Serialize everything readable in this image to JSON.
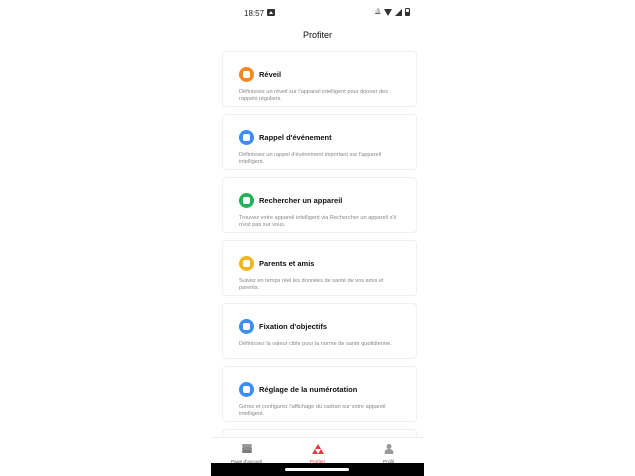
{
  "status_bar": {
    "time": "18:57",
    "icons": [
      "gallery-icon",
      "bell-off-icon",
      "wifi-icon",
      "signal-icon",
      "battery-icon"
    ]
  },
  "header": {
    "title": "Profiter"
  },
  "cards": [
    {
      "title": "Réveil",
      "description": "Définissez un réveil sur l'appareil intelligent pour donner des rappels réguliers.",
      "icon": "alarm-clock-icon",
      "color": "#F28A22"
    },
    {
      "title": "Rappel d'événement",
      "description": "Définissez un rappel d'événement important sur l'appareil intelligent.",
      "icon": "calendar-icon",
      "color": "#3D8DF5"
    },
    {
      "title": "Rechercher un appareil",
      "description": "Trouvez votre appareil intelligent via Rechercher un appareil s'il n'est pas sur vous.",
      "icon": "device-search-icon",
      "color": "#21B35A"
    },
    {
      "title": "Parents et amis",
      "description": "Suivez en temps réel les données de santé de vos amis et parents.",
      "icon": "people-icon",
      "color": "#F2B51B"
    },
    {
      "title": "Fixation d'objectifs",
      "description": "Définissez la valeur cible pour la norme de santé quotidienne.",
      "icon": "target-icon",
      "color": "#3D8DF5"
    },
    {
      "title": "Réglage de la numérotation",
      "description": "Gérez et configurez l'affichage du cadran sur votre appareil intelligent.",
      "icon": "watch-face-icon",
      "color": "#3D8DF5"
    },
    {
      "title": "",
      "description": "",
      "icon": "partial-card-icon",
      "color": "#21B35A"
    }
  ],
  "tabs": [
    {
      "label": "Page d'accueil",
      "icon": "home-stack-icon",
      "active": false
    },
    {
      "label": "Profiter",
      "icon": "profiter-icon",
      "active": true
    },
    {
      "label": "Profil",
      "icon": "person-icon",
      "active": false
    }
  ]
}
